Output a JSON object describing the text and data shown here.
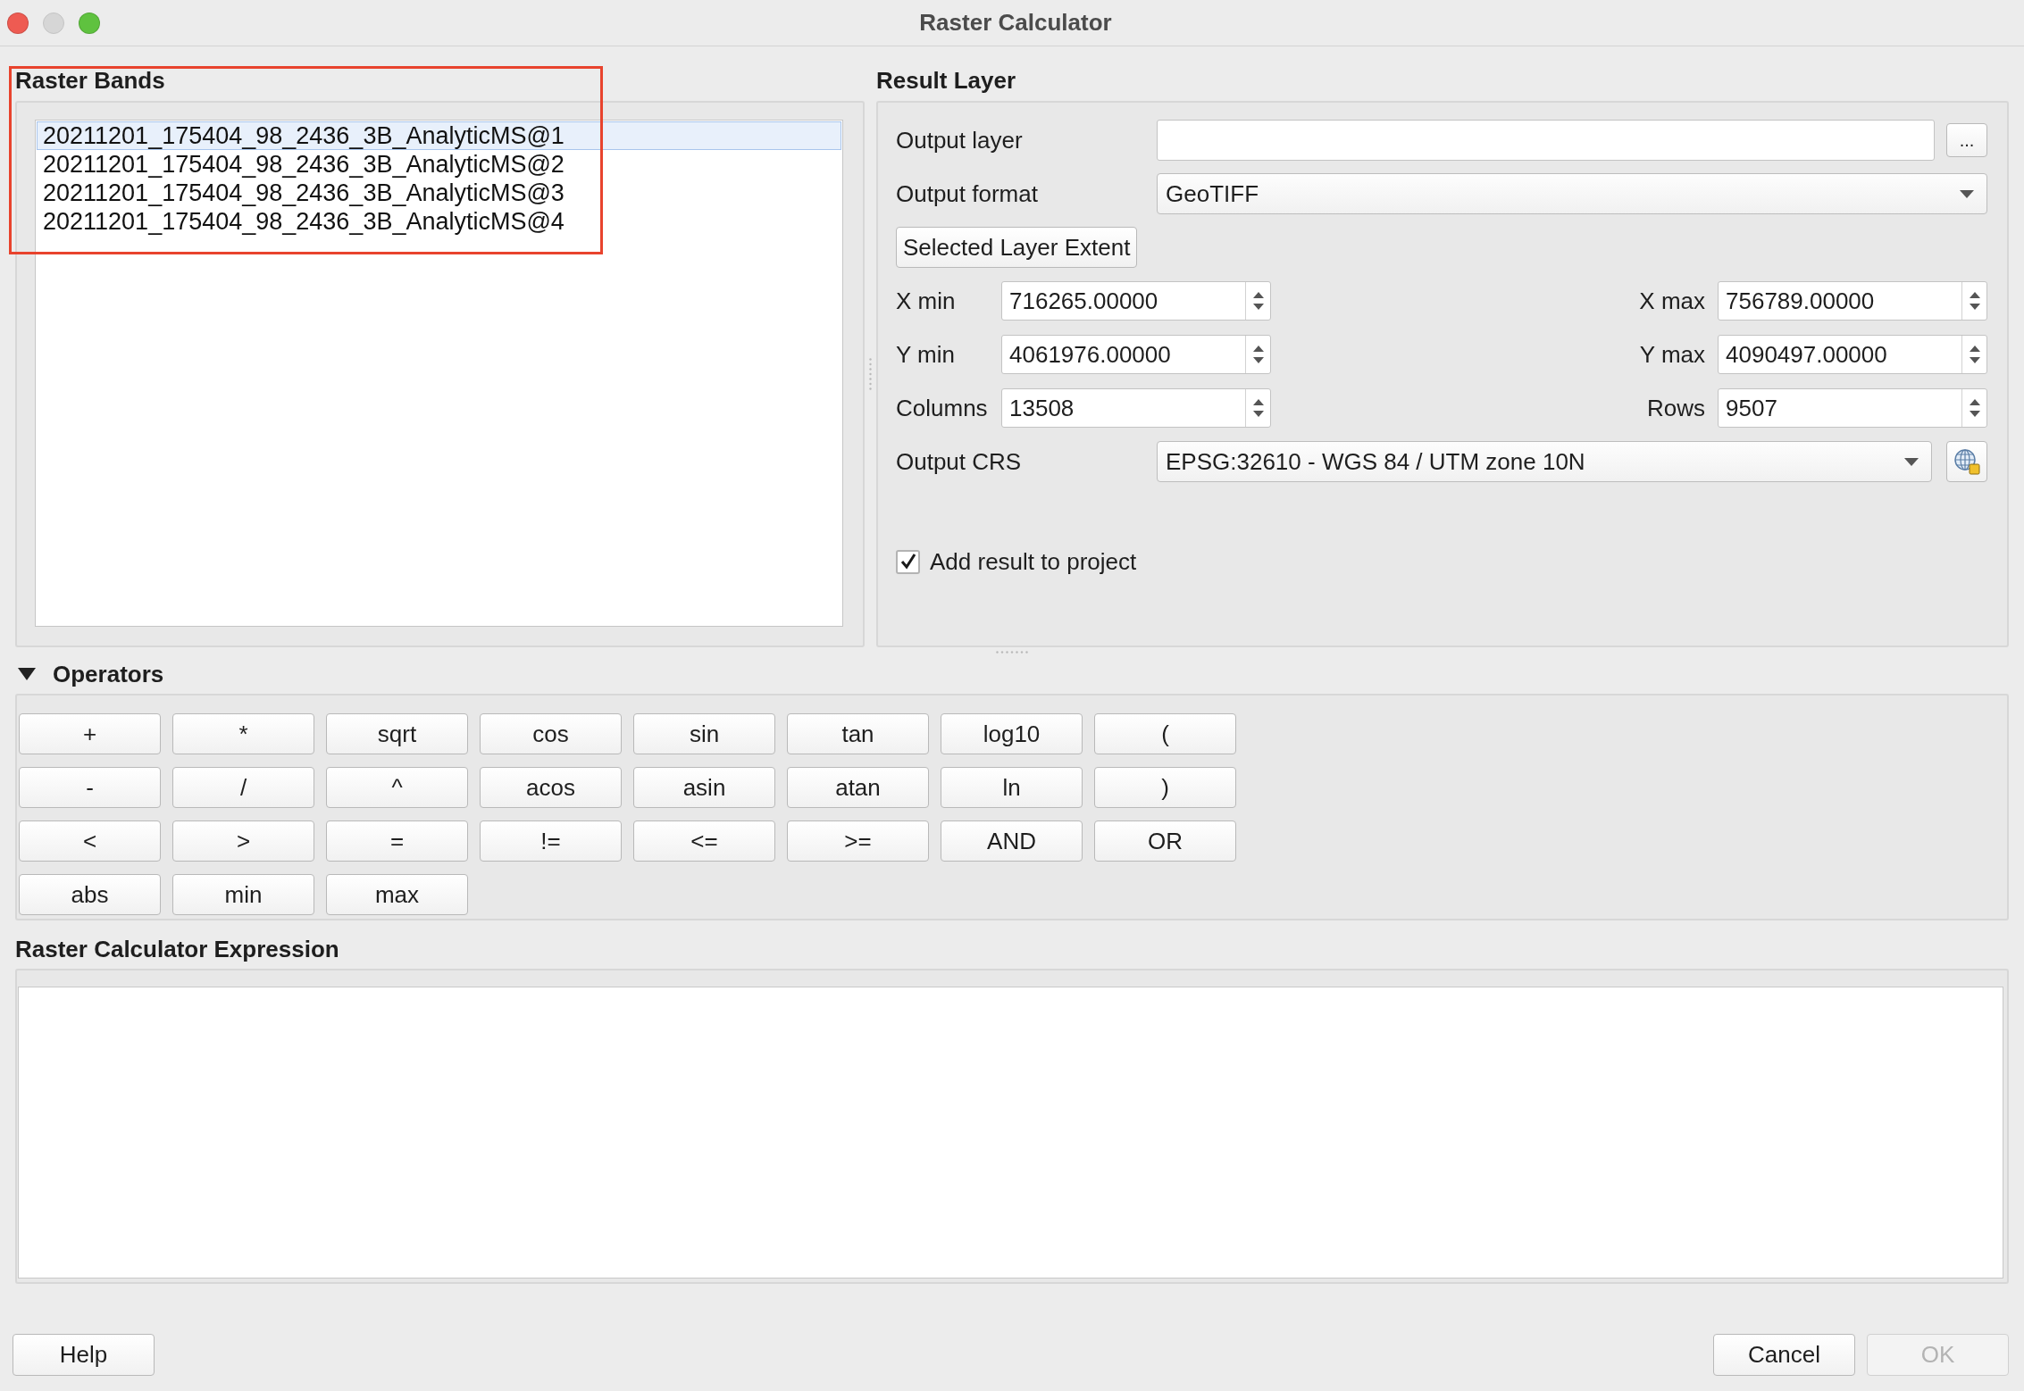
{
  "window": {
    "title": "Raster Calculator",
    "controls": [
      {
        "kind": "close",
        "disabled": false
      },
      {
        "kind": "minimize",
        "disabled": true
      },
      {
        "kind": "zoom",
        "disabled": false
      }
    ]
  },
  "raster_bands": {
    "title": "Raster Bands",
    "highlighted": true,
    "items": [
      {
        "label": "20211201_175404_98_2436_3B_AnalyticMS@1",
        "selected": true
      },
      {
        "label": "20211201_175404_98_2436_3B_AnalyticMS@2",
        "selected": false
      },
      {
        "label": "20211201_175404_98_2436_3B_AnalyticMS@3",
        "selected": false
      },
      {
        "label": "20211201_175404_98_2436_3B_AnalyticMS@4",
        "selected": false
      }
    ]
  },
  "result_layer": {
    "title": "Result Layer",
    "output_layer": {
      "label": "Output layer",
      "browse_button": "..."
    },
    "output_format": {
      "label": "Output format",
      "value": "GeoTIFF"
    },
    "extent_button": "Selected Layer Extent",
    "extent_fields": [
      {
        "label": "X min",
        "value": "716265.00000"
      },
      {
        "label": "X max",
        "value": "756789.00000"
      },
      {
        "label": "Y min",
        "value": "4061976.00000"
      },
      {
        "label": "Y max",
        "value": "4090497.00000"
      },
      {
        "label": "Columns",
        "value": "13508"
      },
      {
        "label": "Rows",
        "value": "9507"
      }
    ],
    "output_crs": {
      "label": "Output CRS",
      "value": "EPSG:32610 - WGS 84 / UTM zone 10N"
    },
    "add_to_project": {
      "label": "Add result to project",
      "checked": true
    }
  },
  "operators": {
    "title": "Operators",
    "expanded": true,
    "buttons": [
      "+",
      "*",
      "sqrt",
      "cos",
      "sin",
      "tan",
      "log10",
      "(",
      "-",
      "/",
      "^",
      "acos",
      "asin",
      "atan",
      "ln",
      ")",
      "<",
      ">",
      "=",
      "!=",
      "<=",
      ">=",
      "AND",
      "OR",
      "abs",
      "min",
      "max"
    ]
  },
  "expression": {
    "title": "Raster Calculator Expression"
  },
  "help_button": {
    "label": "Help",
    "disabled": false
  },
  "dialog_buttons": [
    {
      "label": "Cancel",
      "disabled": false
    },
    {
      "label": "OK",
      "disabled": true
    }
  ]
}
